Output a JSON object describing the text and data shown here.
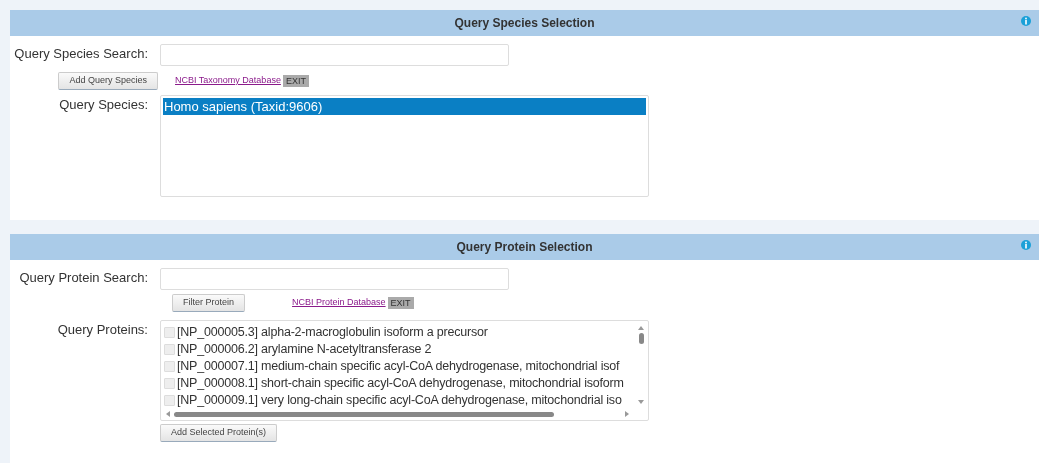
{
  "species_panel": {
    "title": "Query Species Selection",
    "search_label": "Query Species Search:",
    "add_button": "Add Query Species",
    "link": "NCBI Taxonomy Database",
    "exit": "EXIT",
    "list_label": "Query Species:",
    "species": [
      {
        "label": "Homo sapiens (Taxid:9606)",
        "selected": true
      }
    ]
  },
  "protein_panel": {
    "title": "Query Protein Selection",
    "search_label": "Query Protein Search:",
    "filter_button": "Filter Protein",
    "link": "NCBI Protein Database",
    "exit": "EXIT",
    "list_label": "Query Proteins:",
    "proteins": [
      {
        "label": "[NP_000005.3] alpha-2-macroglobulin isoform a precursor",
        "checked": false
      },
      {
        "label": "[NP_000006.2] arylamine N-acetyltransferase 2",
        "checked": false
      },
      {
        "label": "[NP_000007.1] medium-chain specific acyl-CoA dehydrogenase, mitochondrial isof",
        "checked": false
      },
      {
        "label": "[NP_000008.1] short-chain specific acyl-CoA dehydrogenase, mitochondrial isoform",
        "checked": false
      },
      {
        "label": "[NP_000009.1] very long-chain specific acyl-CoA dehydrogenase, mitochondrial iso",
        "checked": false
      }
    ],
    "add_button": "Add Selected Protein(s)"
  }
}
